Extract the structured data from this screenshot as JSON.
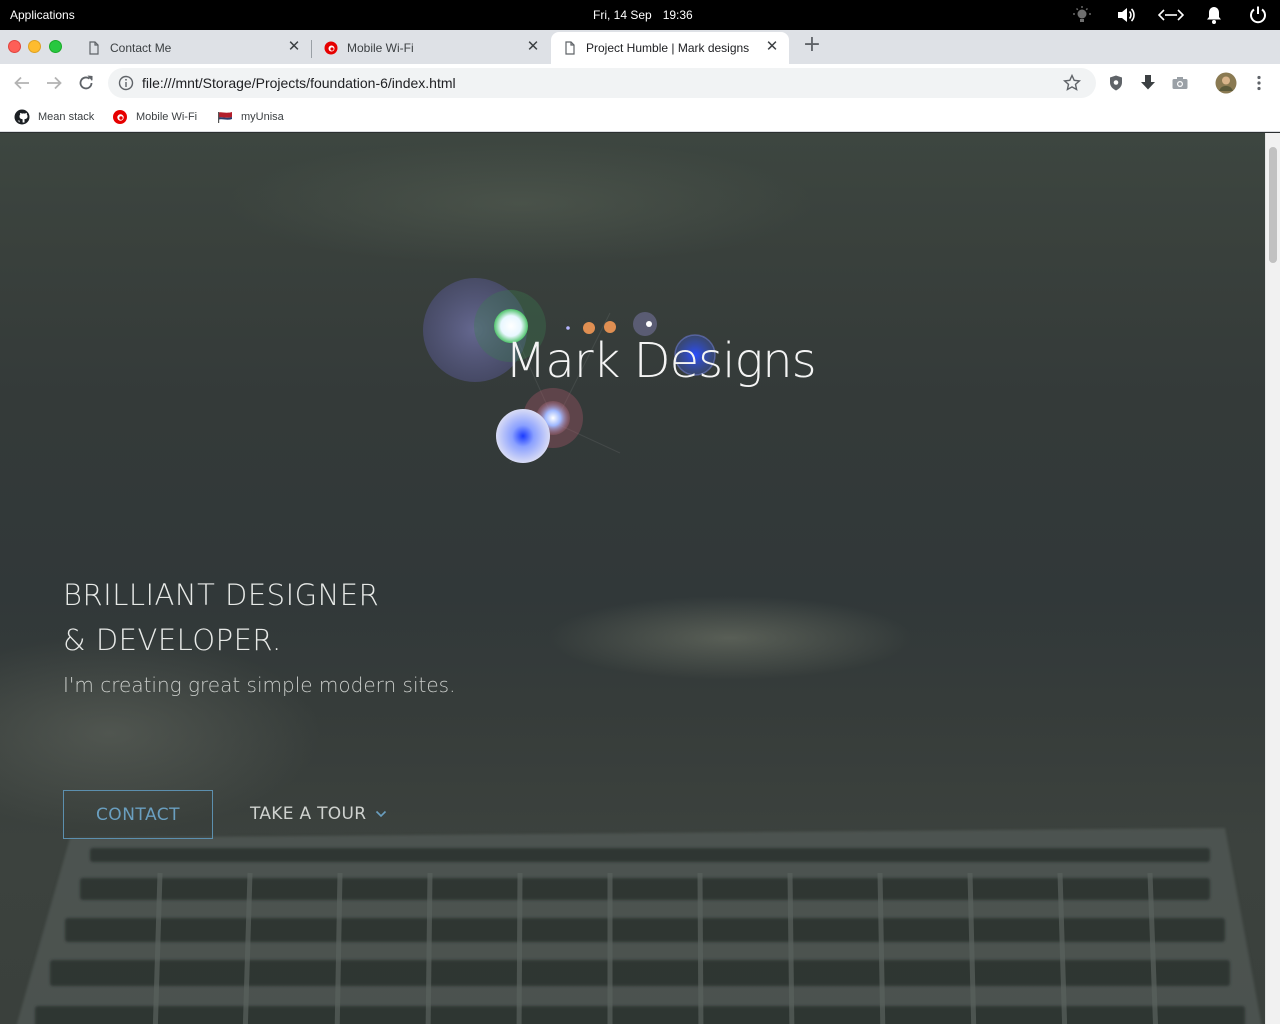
{
  "desktop": {
    "applications_label": "Applications",
    "date": "Fri, 14 Sep",
    "time": "19:36",
    "tray_icons": [
      "brightness-icon",
      "volume-icon",
      "network-icon",
      "notifications-icon",
      "power-icon"
    ]
  },
  "browser": {
    "tabs": [
      {
        "title": "Contact Me",
        "icon": "page-icon",
        "active": false
      },
      {
        "title": "Mobile Wi-Fi",
        "icon": "vodafone-icon",
        "active": false
      },
      {
        "title": "Project Humble | Mark designs",
        "icon": "page-icon",
        "active": true
      }
    ],
    "new_tab_label": "+",
    "close_glyph": "✕",
    "url": "file:///mnt/Storage/Projects/foundation-6/index.html",
    "bookmarks": [
      {
        "label": "Mean stack",
        "icon": "github-icon"
      },
      {
        "label": "Mobile Wi-Fi",
        "icon": "vodafone-icon"
      },
      {
        "label": "myUnisa",
        "icon": "unisa-icon"
      }
    ],
    "colors": {
      "tab_strip": "#dee1e6",
      "toolbar": "#ffffff",
      "omnibox": "#f1f3f4"
    }
  },
  "page": {
    "logo_text": "Mark Designs",
    "headline_line1": "BRILLIANT DESIGNER",
    "headline_line2": "& DEVELOPER.",
    "tagline": "I'm creating great simple modern sites.",
    "contact_button": "CONTACT",
    "tour_button": "TAKE A TOUR",
    "colors": {
      "accent": "#6a9fc0",
      "text": "#e7e9e7"
    }
  }
}
